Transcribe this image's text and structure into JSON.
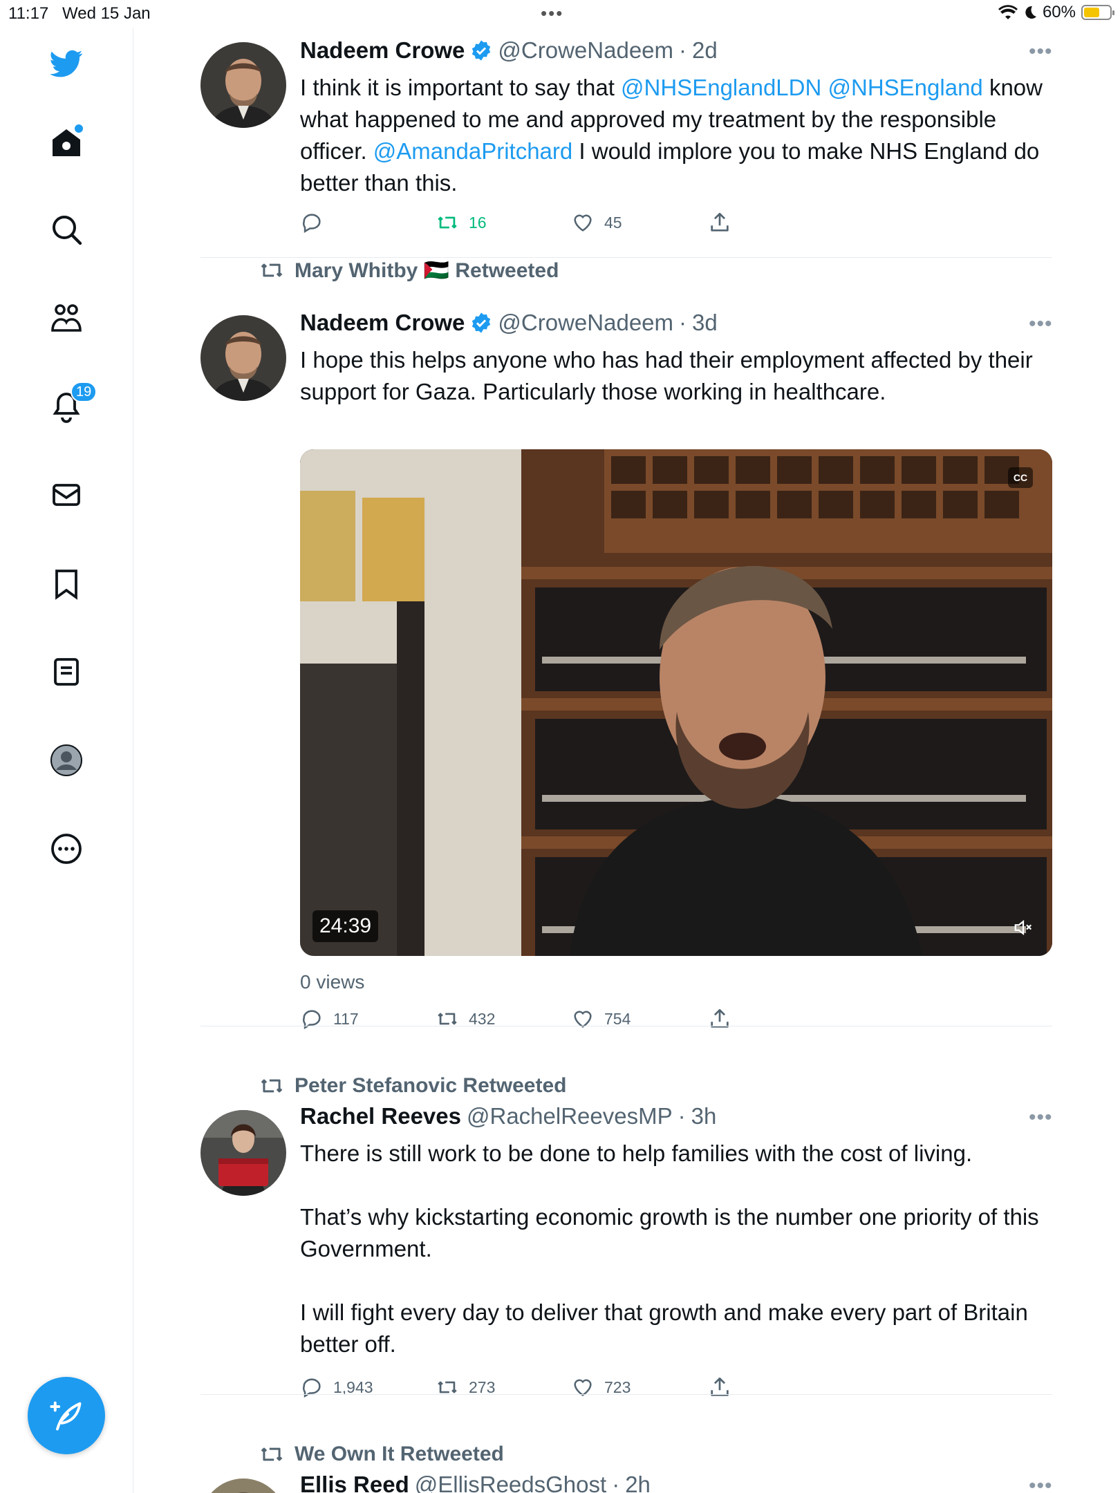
{
  "status_bar": {
    "time": "11:17",
    "date": "Wed 15 Jan",
    "dots": "•••",
    "battery": "60%",
    "battery_level": 0.6
  },
  "sidebar": {
    "items": [
      {
        "icon": "twitter-bird-icon"
      },
      {
        "icon": "home-icon"
      },
      {
        "icon": "search-icon"
      },
      {
        "icon": "communities-icon"
      },
      {
        "icon": "notifications-icon",
        "badge": "19"
      },
      {
        "icon": "messages-icon"
      },
      {
        "icon": "bookmarks-icon"
      },
      {
        "icon": "lists-icon"
      },
      {
        "icon": "profile-icon"
      },
      {
        "icon": "more-icon"
      }
    ],
    "compose_icon": "compose-feather-icon"
  },
  "tweets": [
    {
      "retweeted_by": "",
      "name": "Nadeem Crowe",
      "handle": "@CroweNadeem",
      "sep": "·",
      "time": "2d",
      "verified": true,
      "body_parts": [
        "I think it is important to say that ",
        "@NHSEnglandLDN",
        " ",
        "@NHSEngland",
        " know what happened to me and approved my treatment by the responsible officer. ",
        "@AmandaPritchard",
        " I would implore you to make NHS England do better than this."
      ],
      "replies": "",
      "retweets": "16",
      "likes": "45",
      "retweeted_state": true
    },
    {
      "retweeted_by": "Mary Whitby 🇵🇸 Retweeted",
      "name": "Nadeem Crowe",
      "handle": "@CroweNadeem",
      "sep": "·",
      "time": "3d",
      "verified": true,
      "body": "I hope this helps anyone who has had their employment affected by their support for Gaza. Particularly those working in healthcare.",
      "video": {
        "duration": "24:39",
        "cc": "CC",
        "views": "0 views"
      },
      "replies": "117",
      "retweets": "432",
      "likes": "754"
    },
    {
      "retweeted_by": "Peter Stefanovic Retweeted",
      "name": "Rachel Reeves",
      "handle": "@RachelReevesMP",
      "sep": "·",
      "time": "3h",
      "verified": false,
      "paragraphs": [
        "There is still work to be done to help families with the cost of living.",
        "That’s why kickstarting economic growth is the number one priority of this Government.",
        "I will fight every day to deliver that growth and make every part of Britain better off."
      ],
      "replies": "1,943",
      "retweets": "273",
      "likes": "723"
    },
    {
      "retweeted_by": "We Own It Retweeted",
      "name": "Ellis Reed",
      "handle": "@EllisReedsGhost",
      "sep": "·",
      "time": "2h"
    }
  ],
  "more_label": "•••"
}
